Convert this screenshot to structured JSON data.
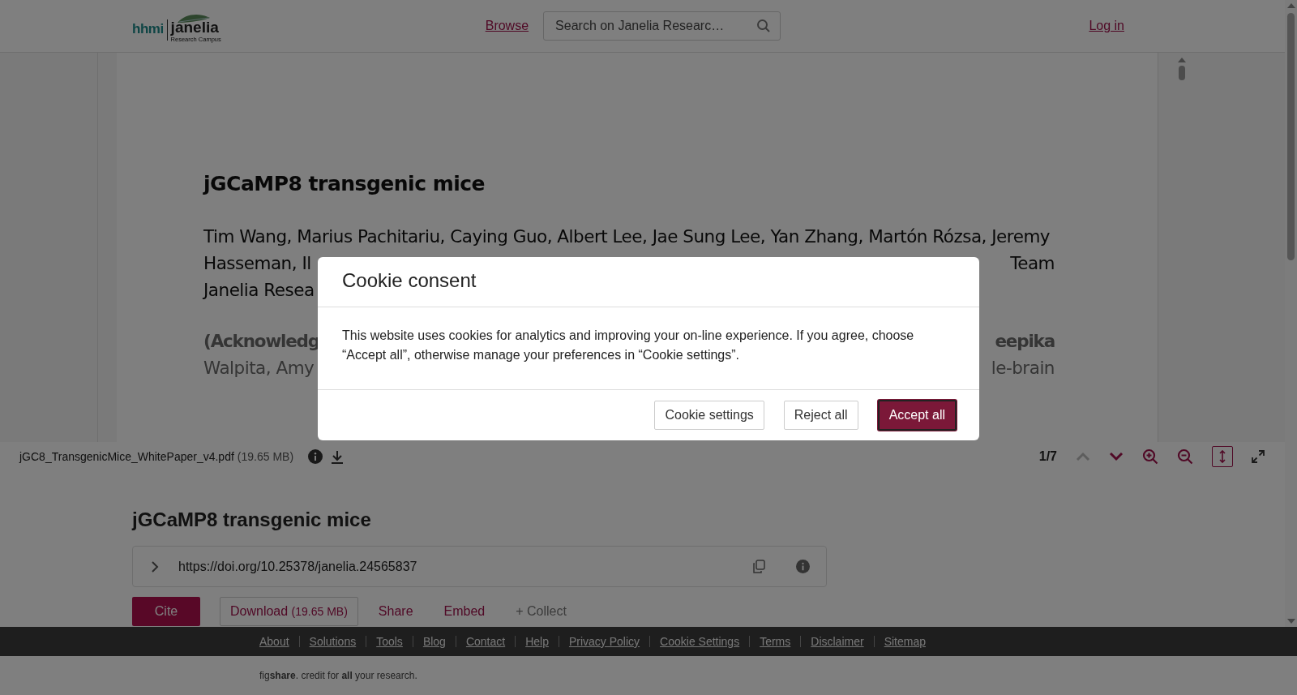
{
  "header": {
    "logo": {
      "brand": "hhmi",
      "name": "janelia",
      "subtitle": "Research Campus"
    },
    "browse_link": "Browse",
    "search": {
      "placeholder": "Search on Janelia Researc…"
    },
    "login_link": "Log in"
  },
  "pdf_viewer": {
    "title": "jGCaMP8 transgenic mice",
    "lines": [
      {
        "kind": "full",
        "text": "Tim Wang, Marius Pachitariu, Caying Guo, Albert Lee, Jae Sung Lee, Yan Zhang, Martón Rózsa, Jeremy"
      },
      {
        "kind": "split",
        "left": "Hasseman, Il",
        "right": "Team"
      },
      {
        "kind": "split",
        "left": "Janelia Resea"
      },
      {
        "kind": "faded-bold",
        "left": "(Acknowledg",
        "right": "eepika"
      },
      {
        "kind": "faded",
        "left": "Walpita, Amy",
        "right": "le-brain"
      }
    ],
    "toolbar": {
      "filename": "jGC8_TransgenicMice_WhitePaper_v4.pdf",
      "size": "(19.65 MB)",
      "page": "1/7",
      "prev_disabled": true,
      "next_disabled": false,
      "fit_height_selected": true
    }
  },
  "item": {
    "title": "jGCaMP8 transgenic mice",
    "doi": "https://doi.org/10.25378/janelia.24565837",
    "actions": [
      {
        "kind": "primary",
        "label": "Cite"
      },
      {
        "kind": "outline",
        "label": "Download",
        "size": "(19.65 MB)"
      },
      {
        "kind": "link",
        "label": "Share"
      },
      {
        "kind": "link",
        "label": "Embed"
      },
      {
        "kind": "muted",
        "label": "+ Collect"
      }
    ]
  },
  "footer": {
    "links": [
      "About",
      "Solutions",
      "Tools",
      "Blog",
      "Contact",
      "Help",
      "Privacy Policy",
      "Cookie Settings",
      "Terms",
      "Disclaimer",
      "Sitemap"
    ],
    "tagline": "fig**share**. credit for **all** your research."
  },
  "cookie_dialog": {
    "title": "Cookie consent",
    "body": "This website uses cookies for analytics and improving your on-line experience. If you agree, choose “Accept all”, otherwise manage your preferences in “Cookie settings”.",
    "buttons": [
      {
        "label": "Cookie settings",
        "primary": false
      },
      {
        "label": "Reject all",
        "primary": false
      },
      {
        "label": "Accept all",
        "primary": true
      }
    ]
  }
}
